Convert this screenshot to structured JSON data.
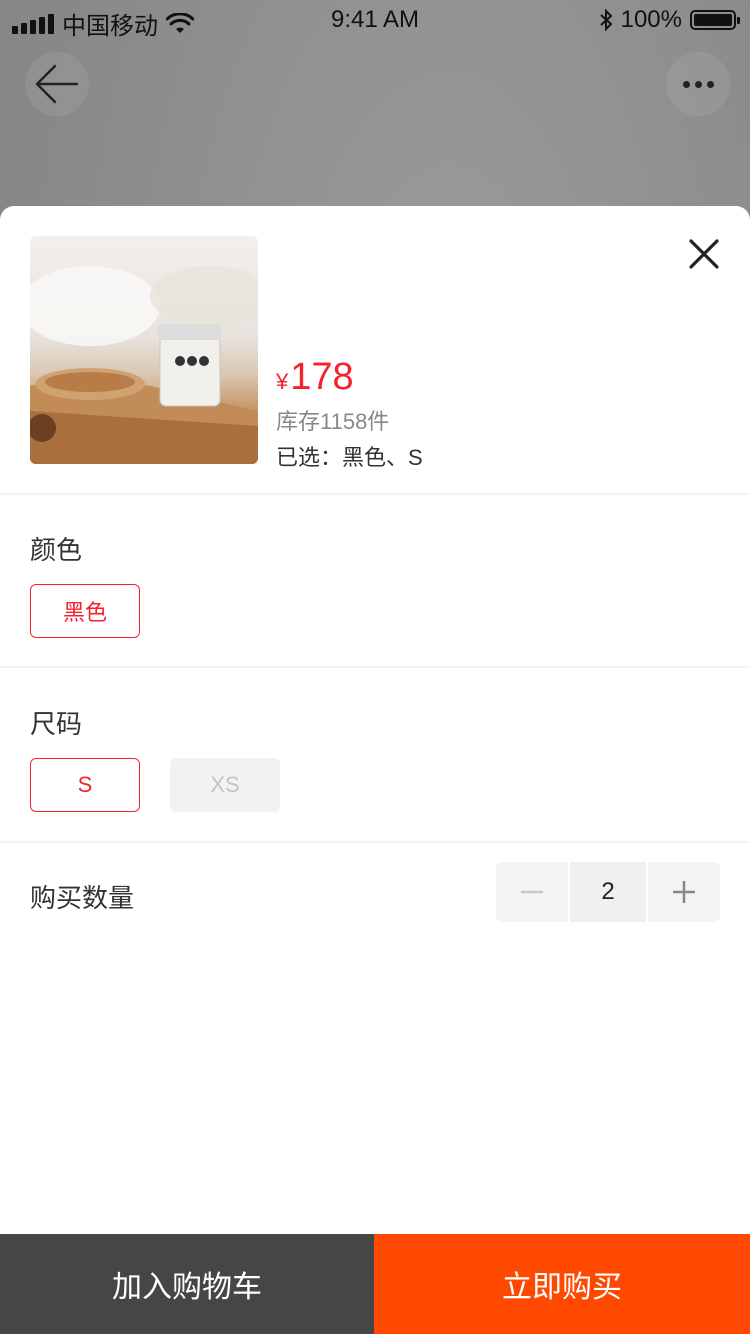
{
  "status_bar": {
    "carrier": "中国移动",
    "time": "9:41 AM",
    "battery": "100%"
  },
  "nav": {
    "back_icon": "arrow-left-icon",
    "more_icon": "more-dots-icon"
  },
  "product": {
    "price_symbol": "¥",
    "price": "178",
    "stock": "库存1158件",
    "selected": "已选：黑色、S"
  },
  "color_section": {
    "title": "颜色",
    "options": [
      "黑色"
    ]
  },
  "size_section": {
    "title": "尺码",
    "options": [
      "S",
      "XS"
    ]
  },
  "quantity": {
    "label": "购买数量",
    "value": "2"
  },
  "footer": {
    "add_to_cart": "加入购物车",
    "buy_now": "立即购买"
  },
  "colors": {
    "accent_red": "#f5222d",
    "buy_orange": "#ff4800",
    "cart_gray": "#464646"
  }
}
